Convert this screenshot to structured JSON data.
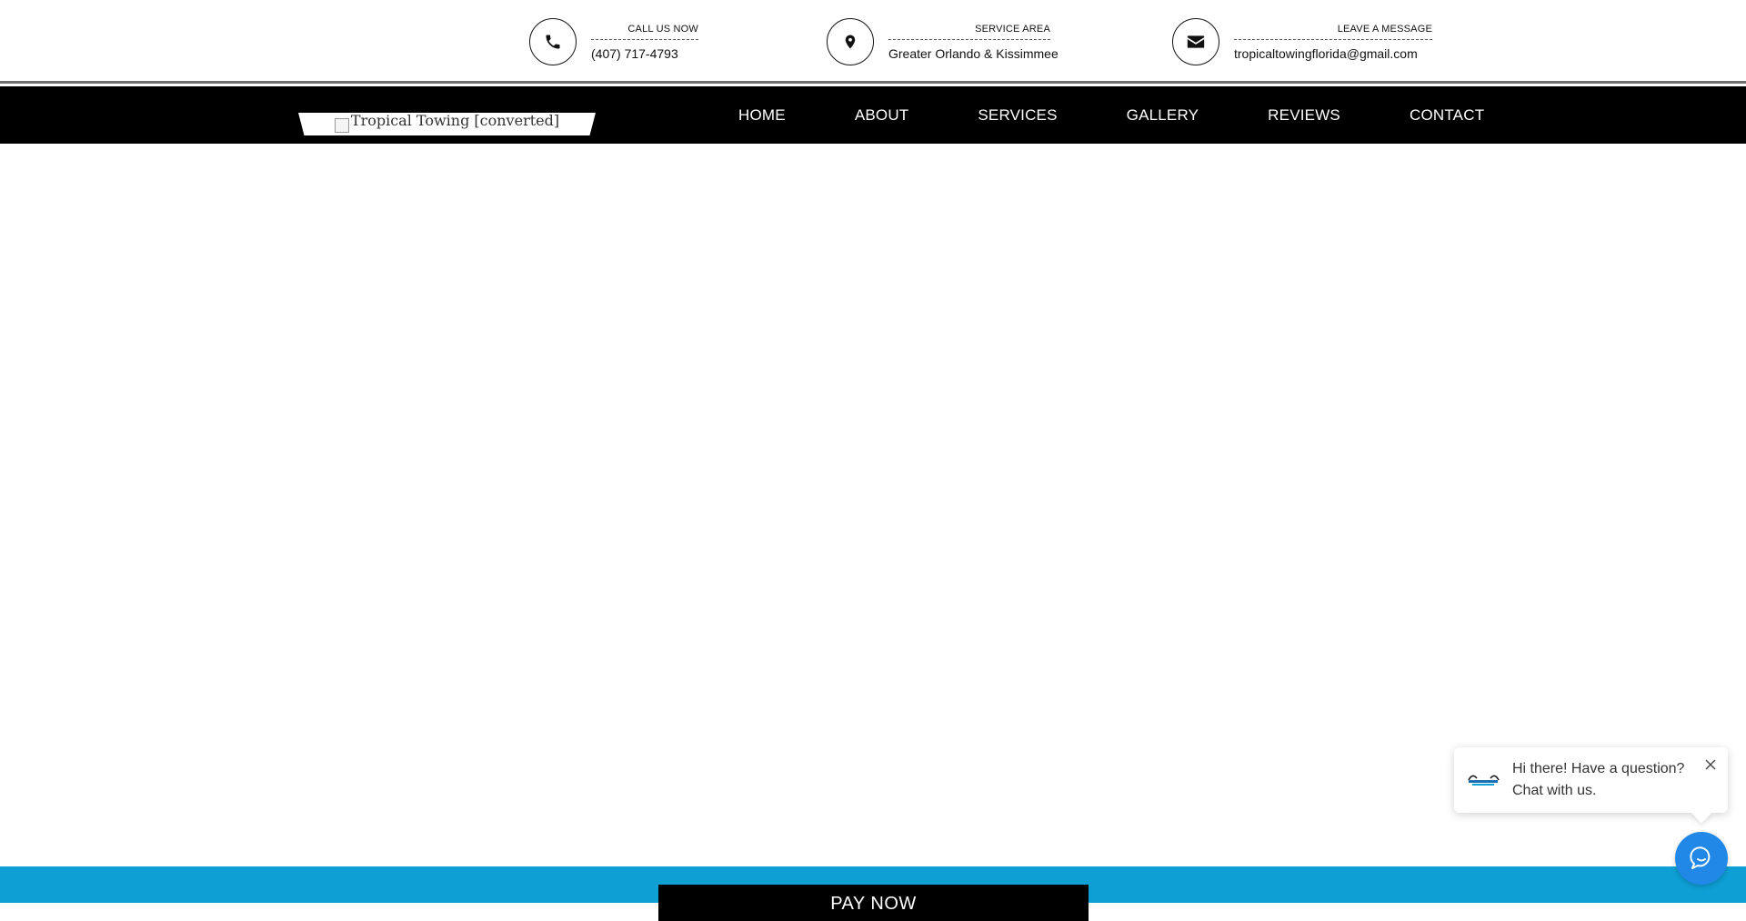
{
  "topbar": {
    "phone": {
      "label": "CALL US NOW",
      "value": "(407) 717-4793",
      "icon": "phone-icon"
    },
    "area": {
      "label": "SERVICE AREA",
      "value": "Greater Orlando & Kissimmee",
      "icon": "map-pin-icon"
    },
    "mail": {
      "label": "LEAVE A MESSAGE",
      "value": "tropicaltowingflorida@gmail.com",
      "icon": "envelope-icon"
    }
  },
  "navbar": {
    "logo_alt": "Tropical Towing [converted]",
    "items": [
      {
        "label": "HOME"
      },
      {
        "label": "ABOUT"
      },
      {
        "label": "SERVICES"
      },
      {
        "label": "GALLERY"
      },
      {
        "label": "REVIEWS"
      },
      {
        "label": "CONTACT"
      }
    ]
  },
  "footer": {
    "pay_label": "PAY NOW"
  },
  "chat": {
    "line1": "Hi there! Have a question?",
    "line2": "Chat with us."
  },
  "colors": {
    "nav_bg": "#000000",
    "footer_band": "#0e9fd4",
    "chat_button": "#2188e8"
  }
}
